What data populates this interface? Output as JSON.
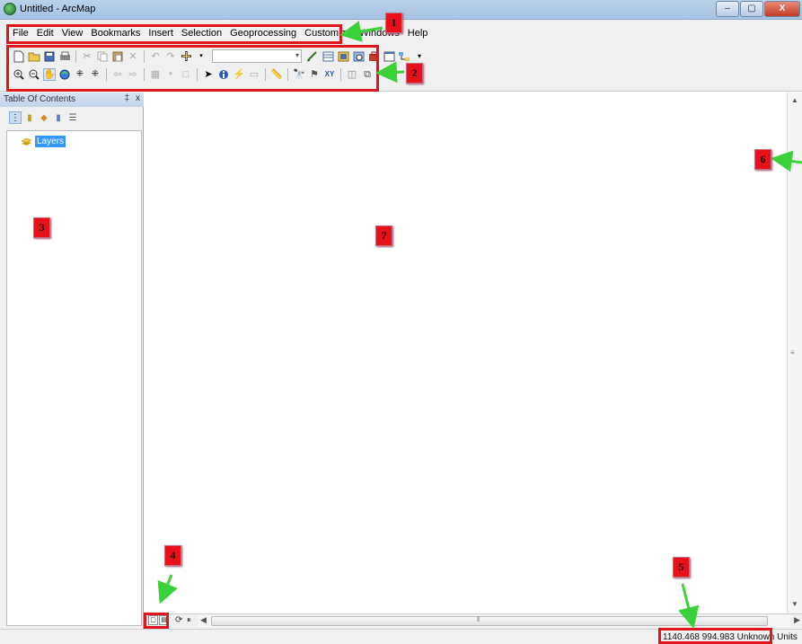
{
  "window": {
    "title": "Untitled - ArcMap",
    "buttons": {
      "minimize": "–",
      "maximize": "▢",
      "close": "X"
    }
  },
  "menubar": {
    "items": [
      "File",
      "Edit",
      "View",
      "Bookmarks",
      "Insert",
      "Selection",
      "Geoprocessing",
      "Customize",
      "Windows",
      "Help"
    ]
  },
  "toolbar": {
    "row1_icons": [
      "new-document-icon",
      "open-folder-icon",
      "save-icon",
      "print-icon",
      "cut-icon",
      "copy-icon",
      "paste-icon",
      "delete-icon",
      "undo-icon",
      "redo-icon",
      "add-data-icon",
      "scale-combo",
      "editor-icon",
      "table-icon",
      "catalog-icon",
      "search-icon",
      "arctoolbox-icon",
      "python-icon",
      "model-icon",
      "more-icon"
    ],
    "row2_icons": [
      "zoom-in-icon",
      "zoom-out-icon",
      "pan-icon",
      "full-extent-icon",
      "fixed-zoom-in-icon",
      "fixed-zoom-out-icon",
      "back-icon",
      "forward-icon",
      "select-features-icon",
      "clear-selection-icon",
      "select-elements-icon",
      "identify-icon",
      "hyperlink-icon",
      "html-popup-icon",
      "measure-icon",
      "find-icon",
      "find-route-icon",
      "go-to-xy-icon",
      "time-slider-icon",
      "viewer-window-icon",
      "more-icon"
    ]
  },
  "toc": {
    "title": "Table Of Contents",
    "pin": "‡",
    "close": "x",
    "root_layer": "Layers"
  },
  "statusbar": {
    "coordinates": "1140.468  994.983 Unknown Units"
  },
  "annotations": [
    "1",
    "2",
    "3",
    "4",
    "5",
    "6",
    "7"
  ],
  "colors": {
    "annotation_red": "#e0161f",
    "arrow_green": "#3bd13b",
    "selection_blue": "#3399ff"
  }
}
